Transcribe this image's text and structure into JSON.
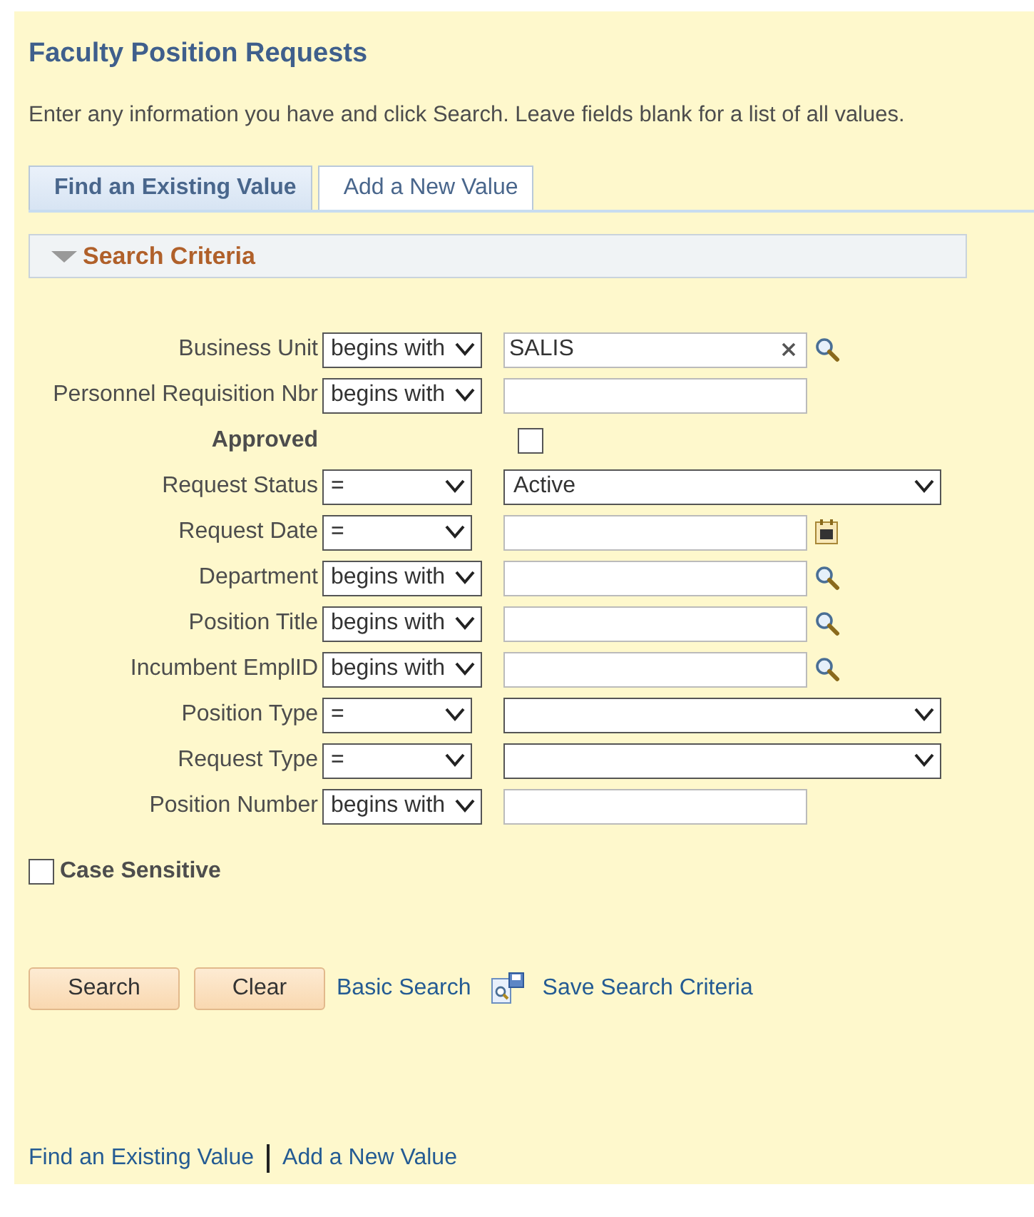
{
  "title": "Faculty Position Requests",
  "instructions": "Enter any information you have and click Search. Leave fields blank for a list of all values.",
  "tabs": [
    {
      "label": "Find an Existing Value",
      "selected": true
    },
    {
      "label": "Add a New Value",
      "selected": false
    }
  ],
  "section": {
    "title": "Search Criteria",
    "expanded": true
  },
  "criteria": [
    {
      "label": "Business Unit",
      "kind": "lookup",
      "operator": "begins with",
      "value": "SALIS",
      "clearable": true
    },
    {
      "label": "Personnel Requisition Nbr",
      "kind": "text",
      "operator": "begins with"
    },
    {
      "label": "Approved",
      "kind": "checkbox",
      "checked": false
    },
    {
      "label": "Request Status",
      "kind": "select",
      "operator": "=",
      "value": "Active"
    },
    {
      "label": "Request Date",
      "kind": "date",
      "operator": "="
    },
    {
      "label": "Department",
      "kind": "lookup",
      "operator": "begins with"
    },
    {
      "label": "Position Title",
      "kind": "lookup",
      "operator": "begins with"
    },
    {
      "label": "Incumbent EmplID",
      "kind": "lookup",
      "operator": "begins with"
    },
    {
      "label": "Position Type",
      "kind": "select",
      "operator": "="
    },
    {
      "label": "Request Type",
      "kind": "select",
      "operator": "="
    },
    {
      "label": "Position Number",
      "kind": "text",
      "operator": "begins with"
    }
  ],
  "case_sensitive": {
    "label": "Case Sensitive",
    "checked": false
  },
  "buttons": [
    "Search",
    "Clear"
  ],
  "actions": [
    {
      "label": "Basic Search",
      "kind": "link"
    },
    {
      "label": "Save Search Criteria",
      "kind": "save"
    }
  ],
  "footer_links": [
    "Find an Existing Value",
    "Add a New Value"
  ]
}
